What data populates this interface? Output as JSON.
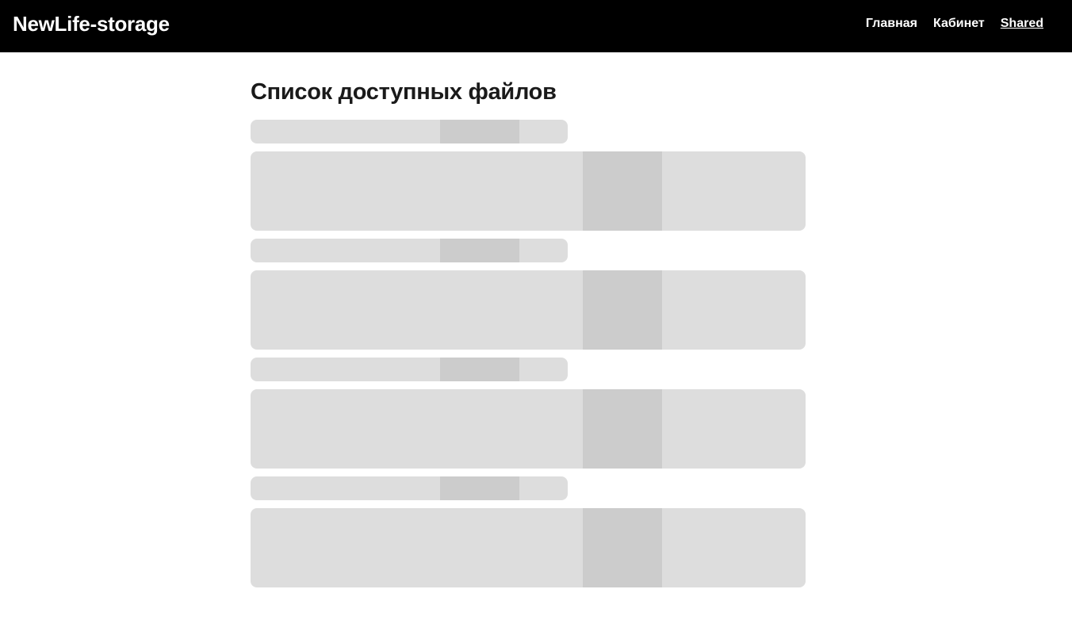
{
  "header": {
    "brand": "NewLife-storage",
    "nav": [
      {
        "label": "Главная",
        "active": false
      },
      {
        "label": "Кабинет",
        "active": false
      },
      {
        "label": "Shared",
        "active": true
      }
    ]
  },
  "main": {
    "title": "Список доступных файлов",
    "loading_placeholders": 4
  },
  "colors": {
    "header_bg": "#000000",
    "skeleton": "#dddddd",
    "skeleton_shine": "#cccccc",
    "title": "#1a1a1a"
  }
}
